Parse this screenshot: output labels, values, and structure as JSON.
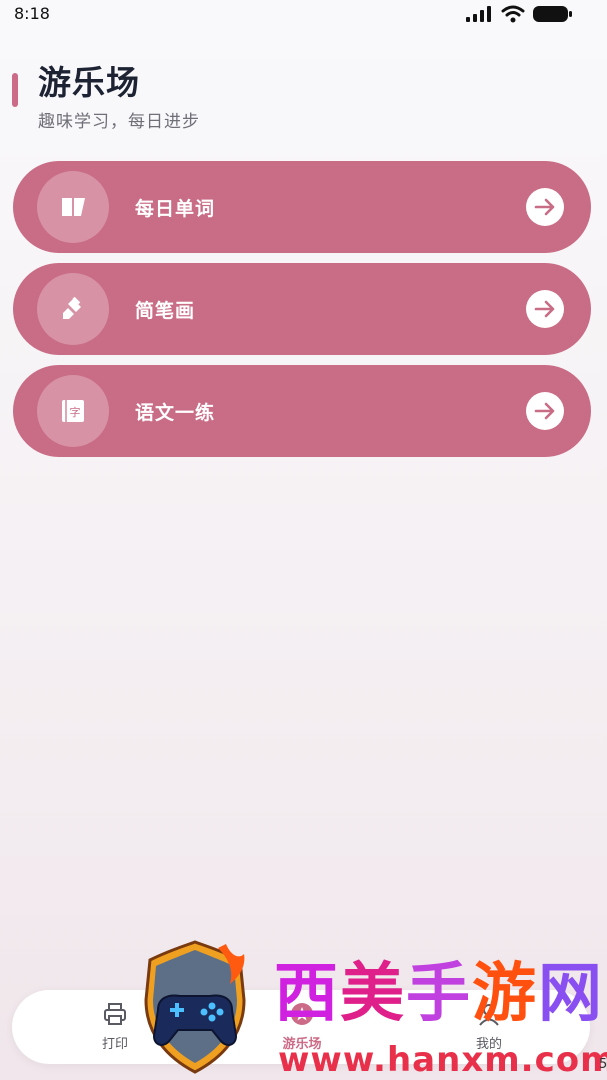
{
  "status_bar": {
    "time": "8:18"
  },
  "header": {
    "title": "游乐场",
    "subtitle": "趣味学习，每日进步"
  },
  "cards": [
    {
      "label": "每日单词",
      "icon": "book-icon"
    },
    {
      "label": "简笔画",
      "icon": "brush-icon"
    },
    {
      "label": "语文一练",
      "icon": "chinese-character-icon",
      "icon_glyph": "字"
    }
  ],
  "bottom_nav": {
    "items": [
      {
        "label": "打印",
        "icon": "printer-icon",
        "active": false
      },
      {
        "label": "游乐场",
        "icon": "star-icon",
        "active": true
      },
      {
        "label": "我的",
        "icon": "user-icon",
        "active": false
      }
    ]
  },
  "watermark": {
    "title_chars": [
      "西",
      "美",
      "手",
      "游",
      "网"
    ],
    "url": "www.hanxm.com"
  },
  "edge_text": "5",
  "colors": {
    "accent": "#c96c86",
    "active_nav": "#cc6b87",
    "title": "#1d2333"
  }
}
